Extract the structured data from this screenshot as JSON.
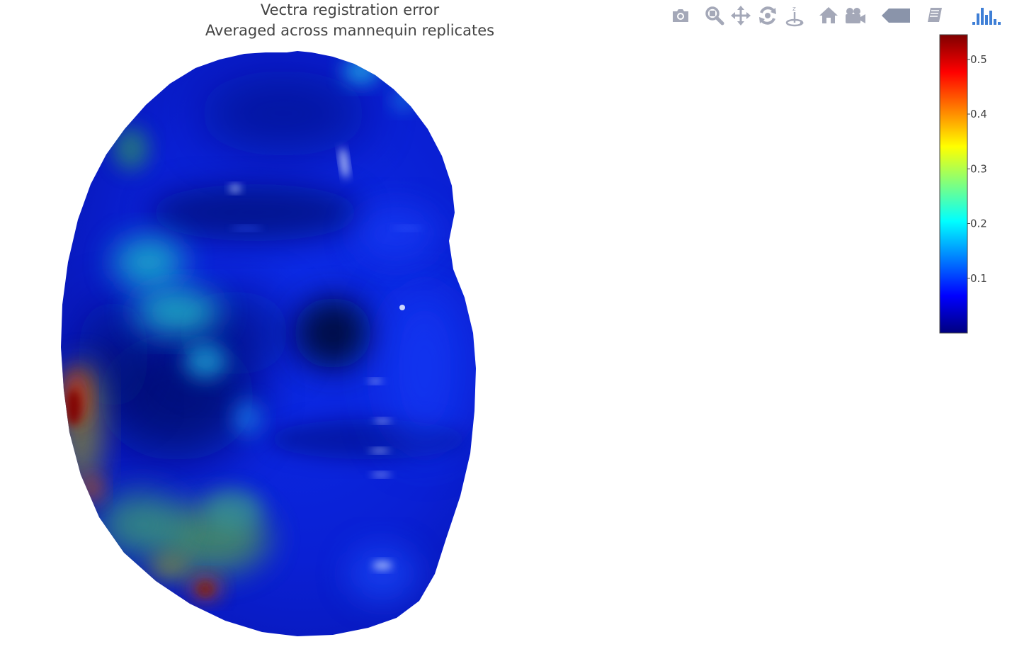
{
  "chart_data": {
    "type": "surface",
    "title": "Vectra registration error",
    "subtitle": "Averaged across mannequin replicates",
    "colorbar": {
      "range": [
        0,
        0.545
      ],
      "ticks": [
        "0.1",
        "0.2",
        "0.3",
        "0.4",
        "0.5"
      ],
      "tick_values": [
        0.1,
        0.2,
        0.3,
        0.4,
        0.5
      ],
      "colorscale": [
        "#00007f",
        "#0000ff",
        "#007fff",
        "#00ffff",
        "#7fff7f",
        "#ffff00",
        "#ff7f00",
        "#ff0000",
        "#7f0000"
      ]
    }
  },
  "modebar": {
    "buttons": [
      "camera-icon",
      "zoom-icon",
      "pan-icon",
      "orbit-rotation-icon",
      "turntable-rotation-icon",
      "reset-camera-icon",
      "default-camera-icon",
      "hover-toggle-icon",
      "spike-lines-icon",
      "plotly-logo-icon"
    ]
  },
  "colors": {
    "modebar_icon": "#a4a8b8",
    "plotly_logo": "#3f7fd6",
    "surface_base": "#0a1fd6",
    "text": "#444444"
  }
}
